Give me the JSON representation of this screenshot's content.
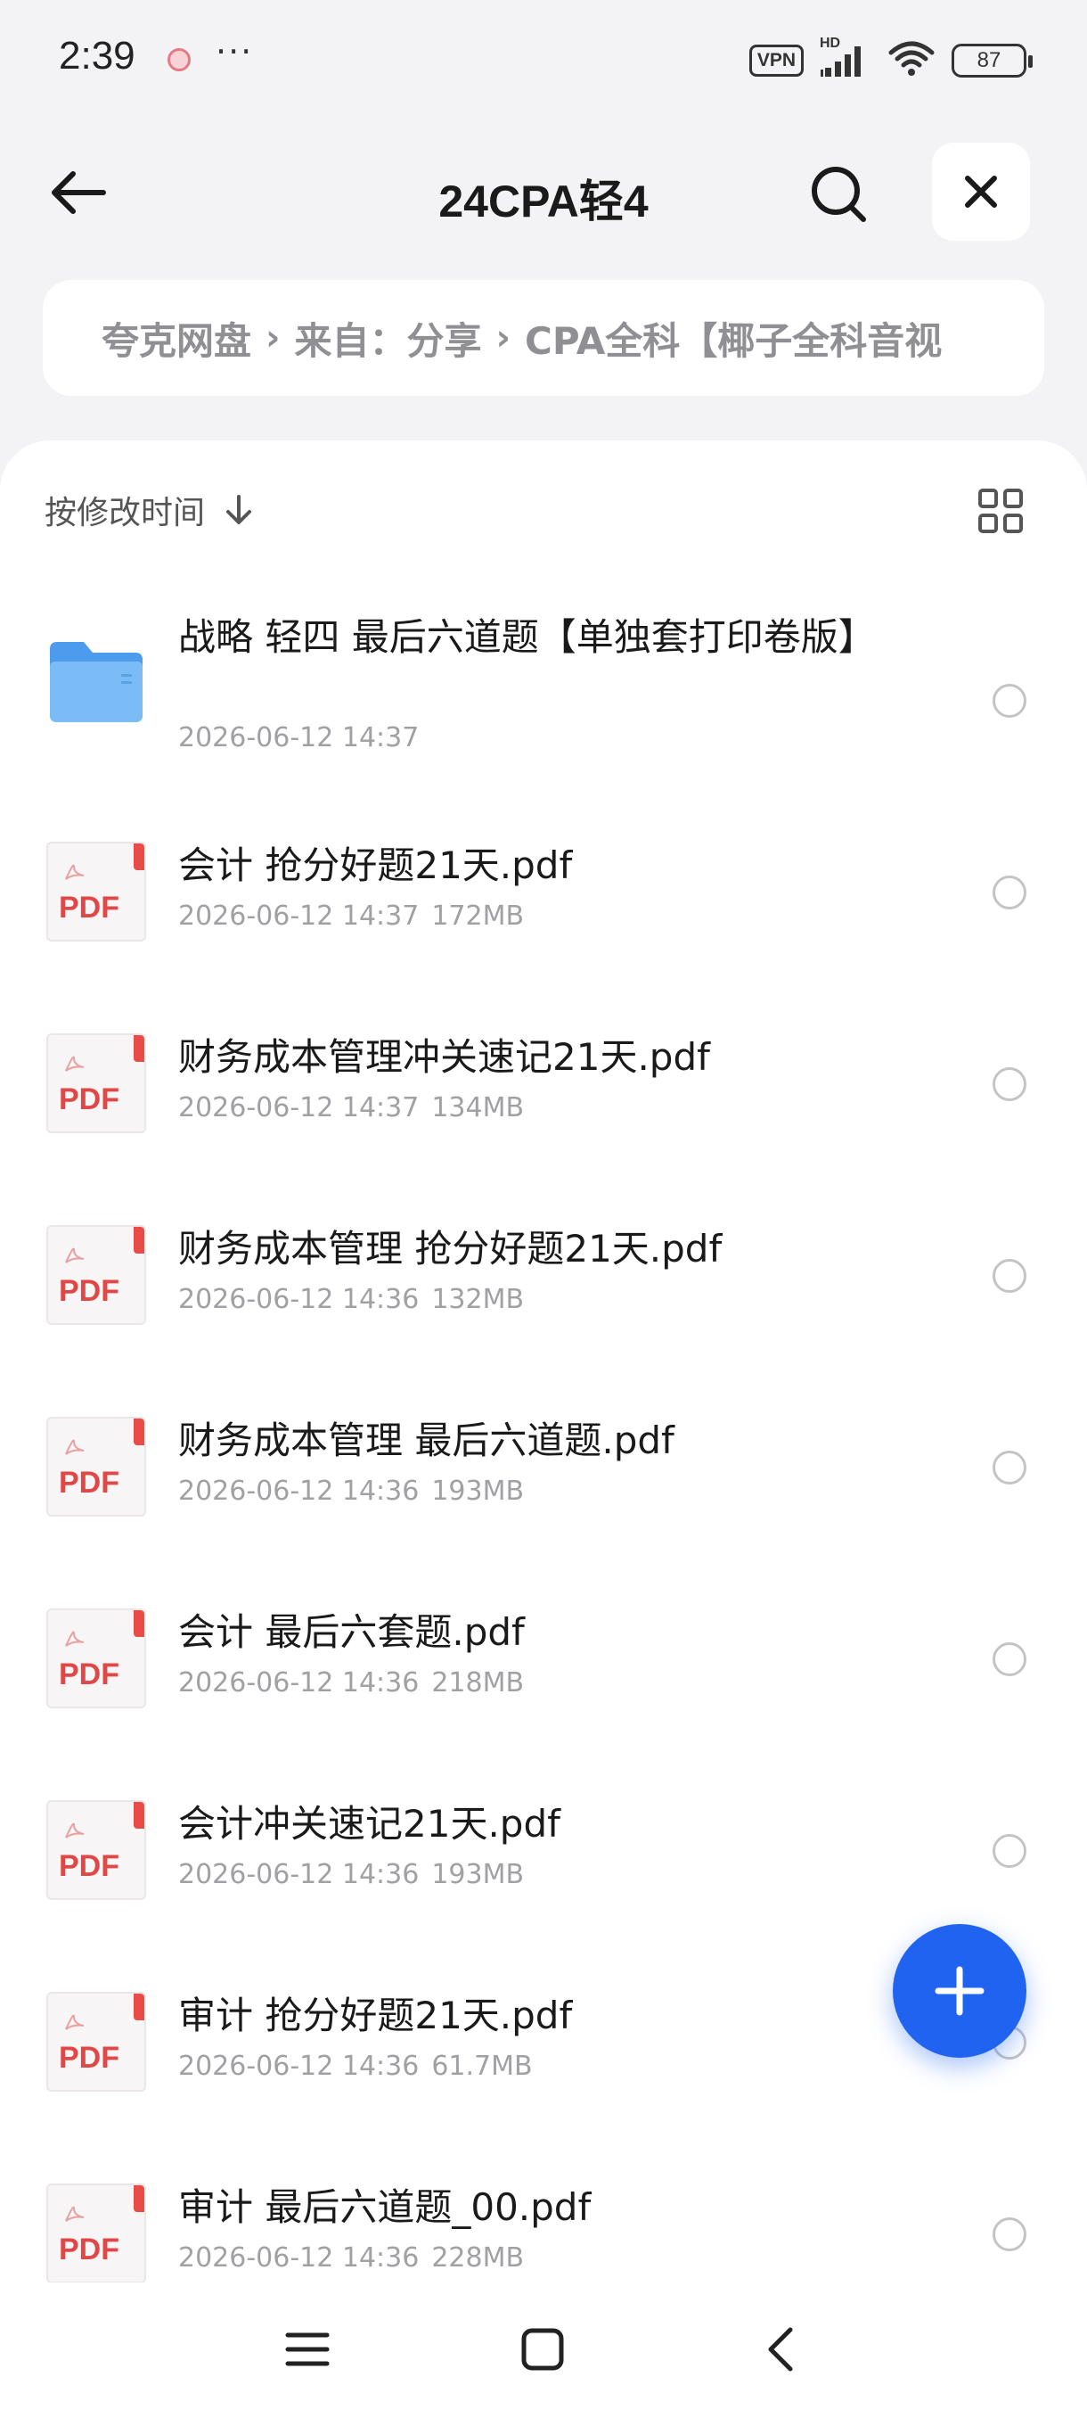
{
  "status_bar": {
    "time": "2:39",
    "more": "···",
    "vpn": "VPN",
    "hd": "HD",
    "battery": "87"
  },
  "header": {
    "title": "24CPA轻4"
  },
  "breadcrumb": {
    "items": [
      "夸克网盘",
      "来自：分享",
      "CPA全科【椰子全科音视"
    ],
    "separator": "›"
  },
  "list": {
    "sort_label": "按修改时间",
    "items": [
      {
        "type": "folder",
        "name": "战略 轻四 最后六道题【单独套打印卷版】",
        "date": "2026-06-12 14:37",
        "size": ""
      },
      {
        "type": "pdf",
        "name": "会计 抢分好题21天.pdf",
        "date": "2026-06-12 14:37",
        "size": "172MB"
      },
      {
        "type": "pdf",
        "name": "财务成本管理冲关速记21天.pdf",
        "date": "2026-06-12 14:37",
        "size": "134MB"
      },
      {
        "type": "pdf",
        "name": "财务成本管理 抢分好题21天.pdf",
        "date": "2026-06-12 14:36",
        "size": "132MB"
      },
      {
        "type": "pdf",
        "name": "财务成本管理 最后六道题.pdf",
        "date": "2026-06-12 14:36",
        "size": "193MB"
      },
      {
        "type": "pdf",
        "name": "会计 最后六套题.pdf",
        "date": "2026-06-12 14:36",
        "size": "218MB"
      },
      {
        "type": "pdf",
        "name": "会计冲关速记21天.pdf",
        "date": "2026-06-12 14:36",
        "size": "193MB"
      },
      {
        "type": "pdf",
        "name": "审计 抢分好题21天.pdf",
        "date": "2026-06-12 14:36",
        "size": "61.7MB"
      },
      {
        "type": "pdf",
        "name": "审计 最后六道题_00.pdf",
        "date": "2026-06-12 14:36",
        "size": "228MB"
      }
    ],
    "pdf_label": "PDF"
  },
  "colors": {
    "accent": "#1f63f0",
    "pdf_red": "#e04848",
    "folder_blue": "#5aa9f2"
  }
}
